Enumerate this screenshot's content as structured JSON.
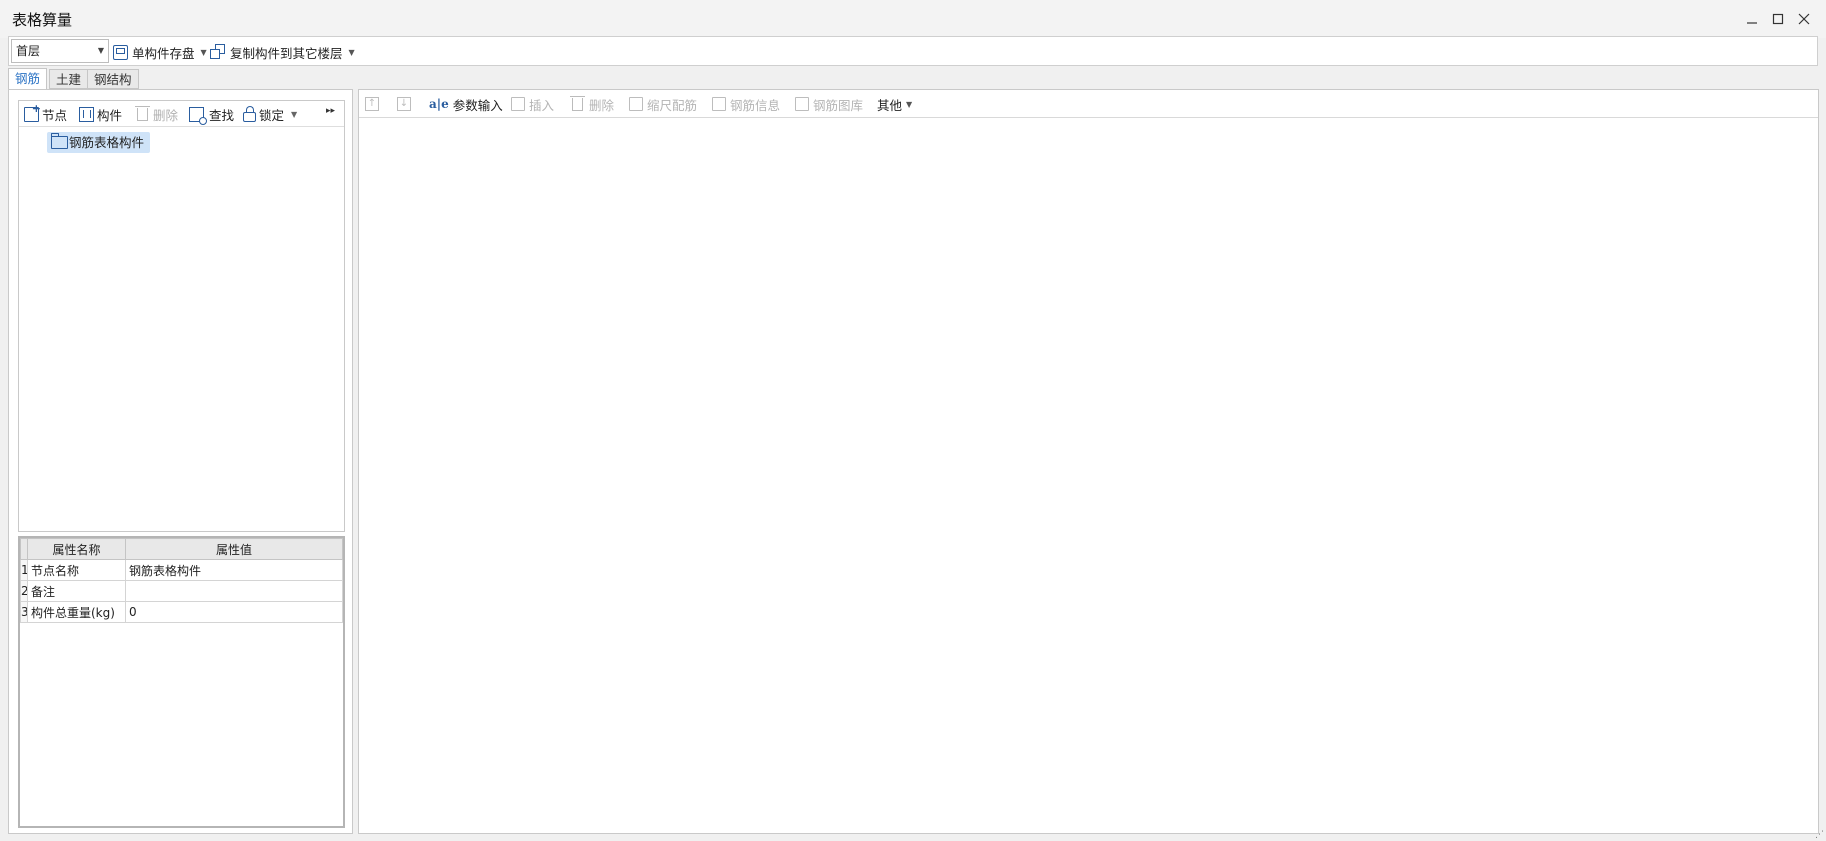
{
  "window": {
    "title": "表格算量"
  },
  "toolbar": {
    "floor_value": "首层",
    "save_label": "单构件存盘",
    "copy_label": "复制构件到其它楼层"
  },
  "tabs": [
    {
      "label": "钢筋"
    },
    {
      "label": "土建"
    },
    {
      "label": "钢结构"
    }
  ],
  "tree_toolbar": {
    "node": "节点",
    "component": "构件",
    "delete": "删除",
    "find": "查找",
    "lock": "锁定"
  },
  "tree": {
    "root": "钢筋表格构件"
  },
  "properties": {
    "headers": [
      "属性名称",
      "属性值"
    ],
    "rows": [
      {
        "index": "1",
        "name": "节点名称",
        "value": "钢筋表格构件"
      },
      {
        "index": "2",
        "name": "备注",
        "value": ""
      },
      {
        "index": "3",
        "name": "构件总重量(kg)",
        "value": "0"
      }
    ]
  },
  "right_toolbar": {
    "param_input": "参数输入",
    "insert": "插入",
    "delete": "删除",
    "scale_rebar": "缩尺配筋",
    "rebar_info": "钢筋信息",
    "rebar_library": "钢筋图库",
    "other": "其他"
  }
}
